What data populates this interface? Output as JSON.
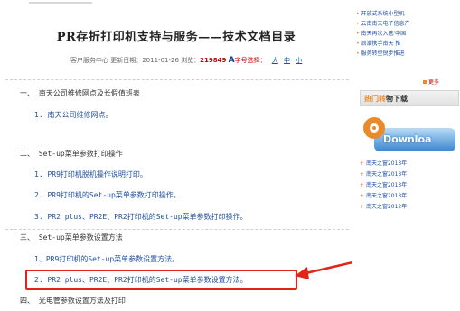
{
  "article": {
    "title": "PR存折打印机支持与服务——技术文档目录",
    "meta_prefix": "客户服务中心 更新日期：2011-01-26 浏览：",
    "views": "219849",
    "font_label": "字号选择：",
    "font_options": [
      "大",
      "中",
      "小"
    ]
  },
  "toc": [
    {
      "kind": "section",
      "text": "一、 南天公司维修网点及长假值班表"
    },
    {
      "kind": "item",
      "text": "1. 南天公司维修网点。"
    },
    {
      "kind": "section",
      "text": "二、 Set-up菜单参数打印操作"
    },
    {
      "kind": "item",
      "text": "1. PR9打印机脱机操作说明打印。"
    },
    {
      "kind": "item",
      "text": "2. PR9打印机的Set-up菜单参数打印操作。"
    },
    {
      "kind": "item",
      "text": "3.  PR2 plus、PR2E、PR2打印机的Set-up菜单参数打印操作。"
    },
    {
      "kind": "section",
      "text": "三、 Set-up菜单参数设置方法"
    },
    {
      "kind": "item",
      "text": "1、PR9打印机的Set-up菜单参数设置方法。"
    },
    {
      "kind": "item",
      "text": "2. PR2 plus、PR2E、PR2打印机的Set-up菜单参数设置方法。"
    },
    {
      "kind": "section",
      "text": "四、 光电管参数设置方法及打印"
    }
  ],
  "sidebar": {
    "news": [
      "开放式系统小型机",
      "云南南天电子信息产",
      "南天再次入选'中国",
      "浪潮携手南天 推",
      "服务转型锐步推进"
    ],
    "more_label": "更多",
    "hot_header_highlight": "热门",
    "hot_header_mid": "转",
    "hot_header_tail": "物下载",
    "download_label": "Downloa",
    "hot_items": [
      "南天之窗2013年",
      "南天之窗2013年",
      "南天之窗2013年",
      "南天之窗2013年",
      "南天之窗2012年"
    ]
  },
  "colors": {
    "accent_red": "#e2231a",
    "link_blue": "#1f4fa0",
    "orange": "#e98a2b"
  }
}
